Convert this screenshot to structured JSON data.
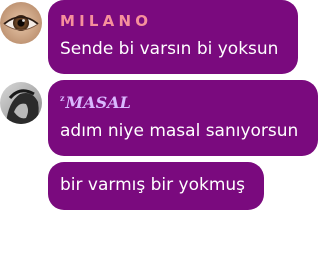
{
  "messages": [
    {
      "sender": "MILANO",
      "text": "Sende bi varsın bi yoksun",
      "avatar_icon": "eye-avatar-icon"
    },
    {
      "sender_prefix": "z",
      "sender": "MASAL",
      "text": "adım niye masal sanıyorsun",
      "avatar_icon": "profile-avatar-icon"
    },
    {
      "text": "bir varmış bir yokmuş"
    }
  ],
  "colors": {
    "bubble": "#7a0a7e",
    "sender_1": "#f6909c",
    "sender_2": "#d9b8ff",
    "text": "#ffffff"
  }
}
